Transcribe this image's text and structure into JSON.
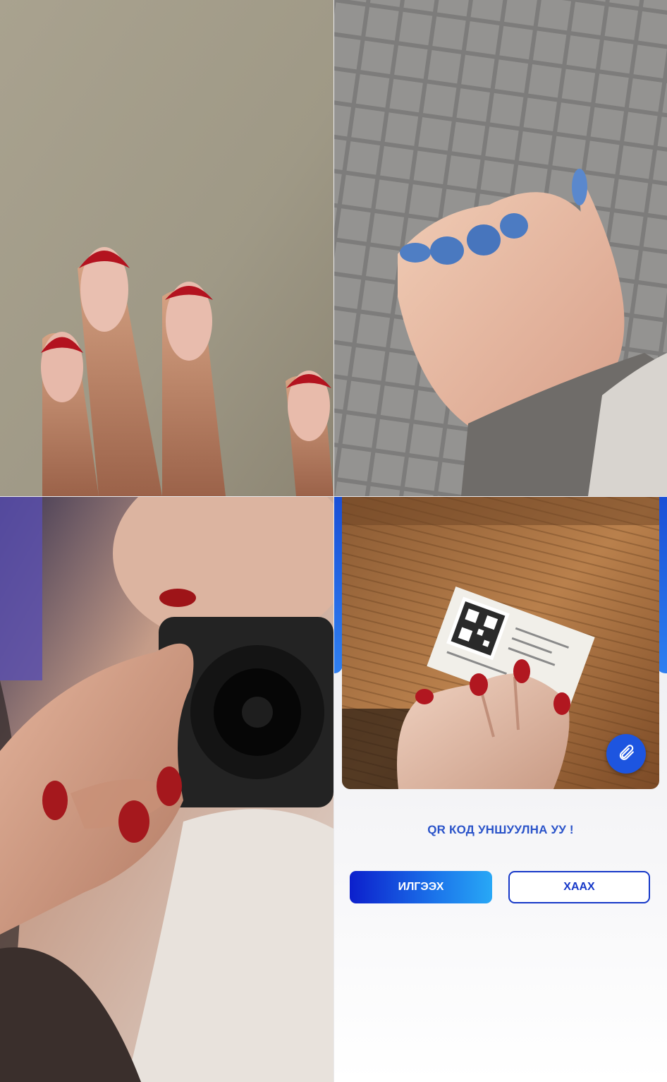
{
  "colors": {
    "primary": "#1d55e0",
    "send_gradient_start": "#0c1fcc",
    "send_gradient_end": "#28a8f6",
    "prompt_text": "#2a53c9",
    "close_border": "#1638c8"
  },
  "panel": {
    "prompt": "QR КОД УНШУУЛНА УУ !",
    "send_label": "ИЛГЭЭХ",
    "close_label": "ХААХ",
    "attach_icon": "paperclip-icon"
  }
}
